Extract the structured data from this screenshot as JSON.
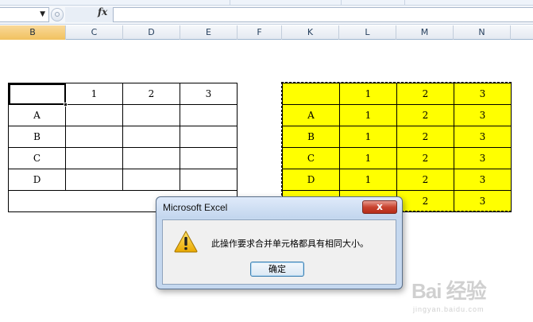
{
  "formula_bar": {
    "namebox_value": "",
    "dropdown_glyph": "▼",
    "fx_label": "fx",
    "formula_value": ""
  },
  "columns": [
    "B",
    "C",
    "D",
    "E",
    "F",
    "K",
    "L",
    "M",
    "N"
  ],
  "left_table": {
    "header": [
      "",
      "1",
      "2",
      "3"
    ],
    "rows": [
      [
        "A",
        "",
        "",
        ""
      ],
      [
        "B",
        "",
        "",
        ""
      ],
      [
        "C",
        "",
        "",
        ""
      ],
      [
        "D",
        "",
        "",
        ""
      ]
    ]
  },
  "right_table": {
    "header": [
      "",
      "1",
      "2",
      "3"
    ],
    "rows": [
      [
        "A",
        "1",
        "2",
        "3"
      ],
      [
        "B",
        "1",
        "2",
        "3"
      ],
      [
        "C",
        "1",
        "2",
        "3"
      ],
      [
        "D",
        "1",
        "2",
        "3"
      ],
      [
        "",
        "",
        "2",
        "3"
      ]
    ],
    "fill_color": "#ffff00"
  },
  "dialog": {
    "title": "Microsoft Excel",
    "close_glyph": "x",
    "icon": "warning-icon",
    "message": "此操作要求合并单元格都具有相同大小。",
    "ok_label": "确定"
  },
  "watermark": {
    "logo_text": "Bai 经验",
    "sub_text": "jingyan.baidu.com"
  },
  "colors": {
    "selected_column_header": "#f1c15f",
    "highlight_fill": "#ffff00",
    "close_button": "#c9432f"
  }
}
